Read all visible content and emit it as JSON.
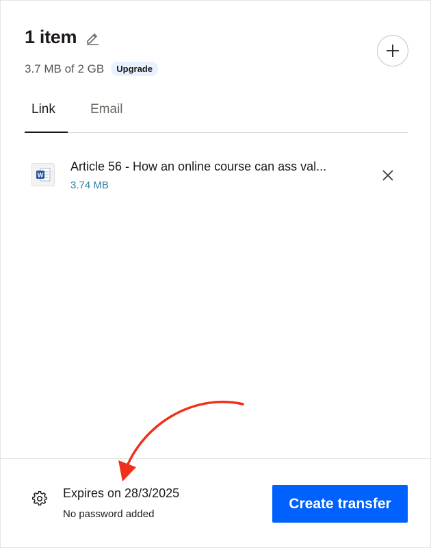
{
  "header": {
    "title": "1 item",
    "quota": "3.7 MB of 2 GB",
    "upgrade_label": "Upgrade"
  },
  "tabs": [
    {
      "label": "Link",
      "active": true
    },
    {
      "label": "Email",
      "active": false
    }
  ],
  "files": [
    {
      "name": "Article 56 - How an online course can ass val...",
      "size": "3.74 MB",
      "icon": "word-document-icon"
    }
  ],
  "footer": {
    "expires": "Expires on 28/3/2025",
    "password": "No password added",
    "create_label": "Create transfer"
  },
  "colors": {
    "accent": "#0061fe",
    "file_size": "#2a7fa6",
    "annotation_arrow": "#f0301a",
    "upgrade_bg": "#e8f1fe"
  },
  "icons": {
    "edit": "pencil-icon",
    "add": "plus-icon",
    "remove": "close-icon",
    "settings": "gear-icon"
  }
}
